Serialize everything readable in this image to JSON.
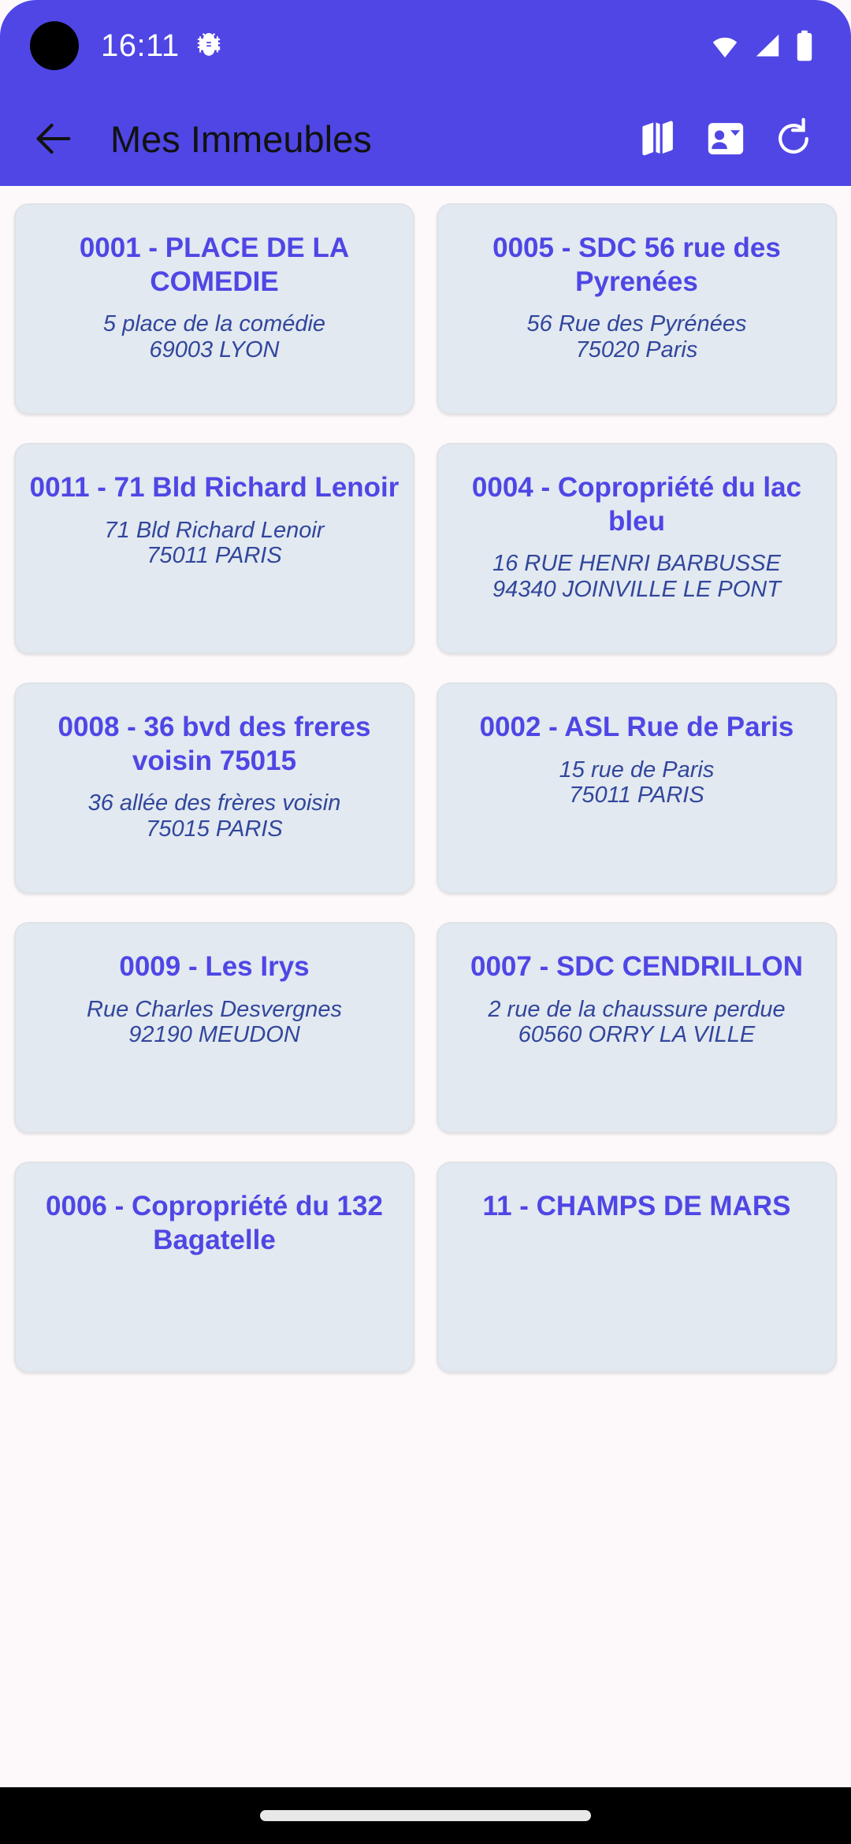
{
  "status_bar": {
    "time": "16:11",
    "icons": {
      "camera": "camera-hole",
      "debug": "android-bug-icon",
      "wifi": "wifi-icon",
      "signal": "cellular-signal-icon",
      "battery": "battery-icon"
    }
  },
  "app_bar": {
    "back_label": "back-arrow",
    "title": "Mes Immeubles",
    "actions": [
      {
        "name": "map-icon",
        "label": "Carte"
      },
      {
        "name": "contact-card-icon",
        "label": "Contacts"
      },
      {
        "name": "refresh-icon",
        "label": "Rafraîchir"
      }
    ]
  },
  "colors": {
    "appbar_bg": "#4f46e5",
    "card_bg": "#e2e9f0",
    "card_border": "#dfe3e6",
    "title_text": "#4f46e5",
    "address_text": "#32469c",
    "page_bg": "#fdf9fb",
    "navbar_bg": "#000000"
  },
  "buildings": [
    {
      "ref": "0001 - PLACE DE LA COMEDIE",
      "address_line1": "5 place de la comédie",
      "address_line2": "69003 LYON"
    },
    {
      "ref": "0005 - SDC 56 rue des Pyrenées",
      "address_line1": "56 Rue des Pyrénées",
      "address_line2": "75020 Paris"
    },
    {
      "ref": "0011 - 71 Bld Richard Lenoir",
      "address_line1": "71 Bld Richard Lenoir",
      "address_line2": "75011 PARIS"
    },
    {
      "ref": "0004 - Copropriété du lac bleu",
      "address_line1": "16 RUE HENRI BARBUSSE",
      "address_line2": "94340 JOINVILLE LE PONT"
    },
    {
      "ref": "0008 - 36 bvd des freres voisin 75015",
      "address_line1": "36 allée des frères voisin",
      "address_line2": "75015 PARIS"
    },
    {
      "ref": "0002 - ASL Rue de Paris",
      "address_line1": "15 rue de Paris",
      "address_line2": "75011 PARIS"
    },
    {
      "ref": "0009 - Les Irys",
      "address_line1": "Rue Charles Desvergnes",
      "address_line2": "92190 MEUDON"
    },
    {
      "ref": "0007 - SDC CENDRILLON",
      "address_line1": "2 rue de la chaussure perdue",
      "address_line2": "60560 ORRY LA VILLE"
    },
    {
      "ref": "0006 - Copropriété du 132 Bagatelle",
      "address_line1": "",
      "address_line2": ""
    },
    {
      "ref": "11 - CHAMPS DE MARS",
      "address_line1": "",
      "address_line2": ""
    }
  ]
}
